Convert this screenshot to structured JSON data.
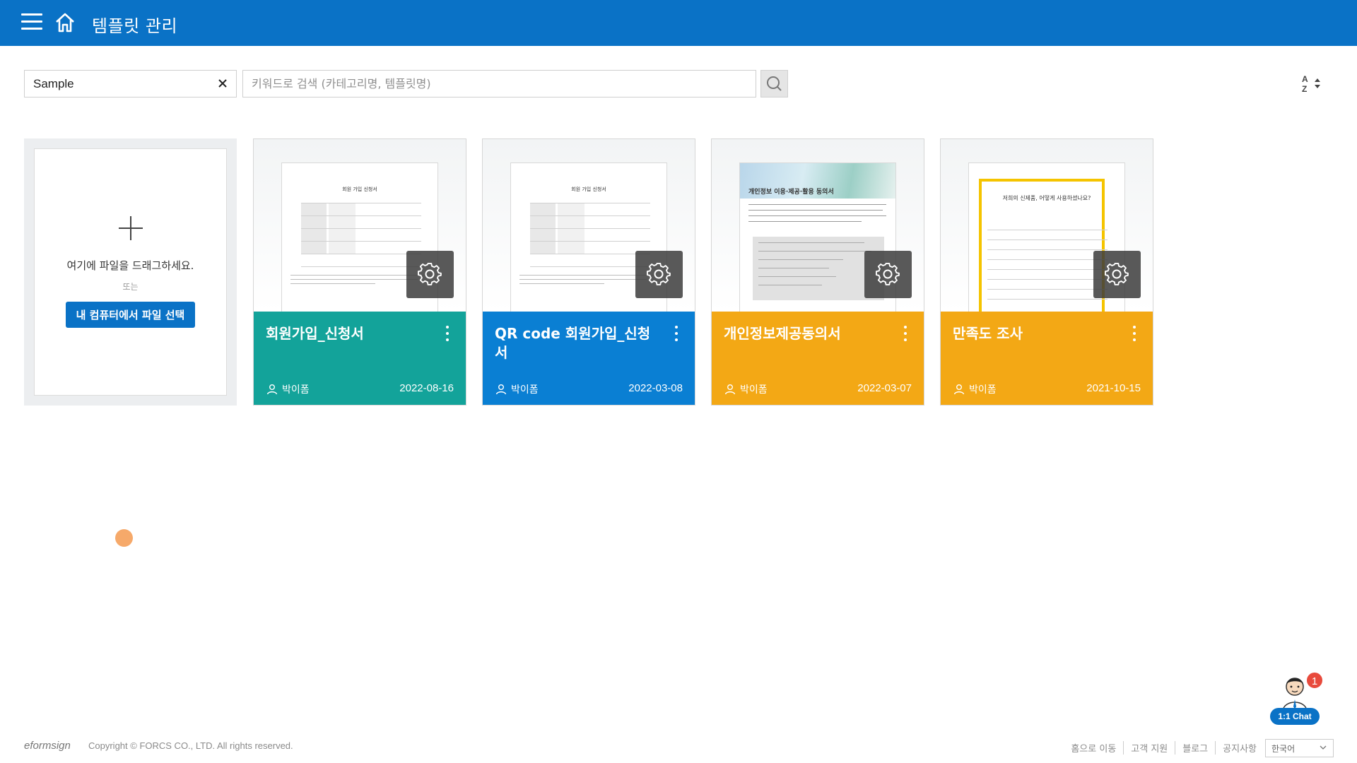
{
  "header": {
    "title": "템플릿 관리",
    "bg_color": "#0a72c6",
    "menu_icon": "hamburger-menu-icon",
    "home_icon": "home-icon"
  },
  "filter": {
    "value": "Sample",
    "clear_icon": "close-icon"
  },
  "search": {
    "placeholder": "키워드로 검색 (카테고리명, 템플릿명)",
    "icon": "search-icon"
  },
  "sort": {
    "icon": "sort-az-icon"
  },
  "upload": {
    "drag_text": "여기에 파일을 드래그하세요.",
    "or_text": "또는",
    "button_label": "내 컴퓨터에서 파일 선택",
    "icon": "plus-icon"
  },
  "templates": [
    {
      "name": "회원가입_신청서",
      "owner": "박이폼",
      "date": "2022-08-16",
      "color": "#13a39a",
      "thumb_title": "회원 가입 신청서"
    },
    {
      "name": "QR code 회원가입_신청서",
      "owner": "박이폼",
      "date": "2022-03-08",
      "color": "#0a7fd3",
      "thumb_title": "회원 가입 신청서"
    },
    {
      "name": "개인정보제공동의서",
      "owner": "박이폼",
      "date": "2022-03-07",
      "color": "#f3a815",
      "thumb_title": "개인정보 이용·제공·활용 동의서"
    },
    {
      "name": "만족도 조사",
      "owner": "박이폼",
      "date": "2021-10-15",
      "color": "#f3a815",
      "thumb_title": "저희의 신제품, 어떻게 사용하셨나요?"
    }
  ],
  "chat": {
    "badge": "1",
    "label": "1:1 Chat"
  },
  "footer": {
    "logo": "eformsign",
    "copyright": "Copyright © FORCS CO., LTD. All rights reserved.",
    "links": [
      "홈으로 이동",
      "고객 지원",
      "블로그",
      "공지사항"
    ],
    "language": "한국어"
  }
}
